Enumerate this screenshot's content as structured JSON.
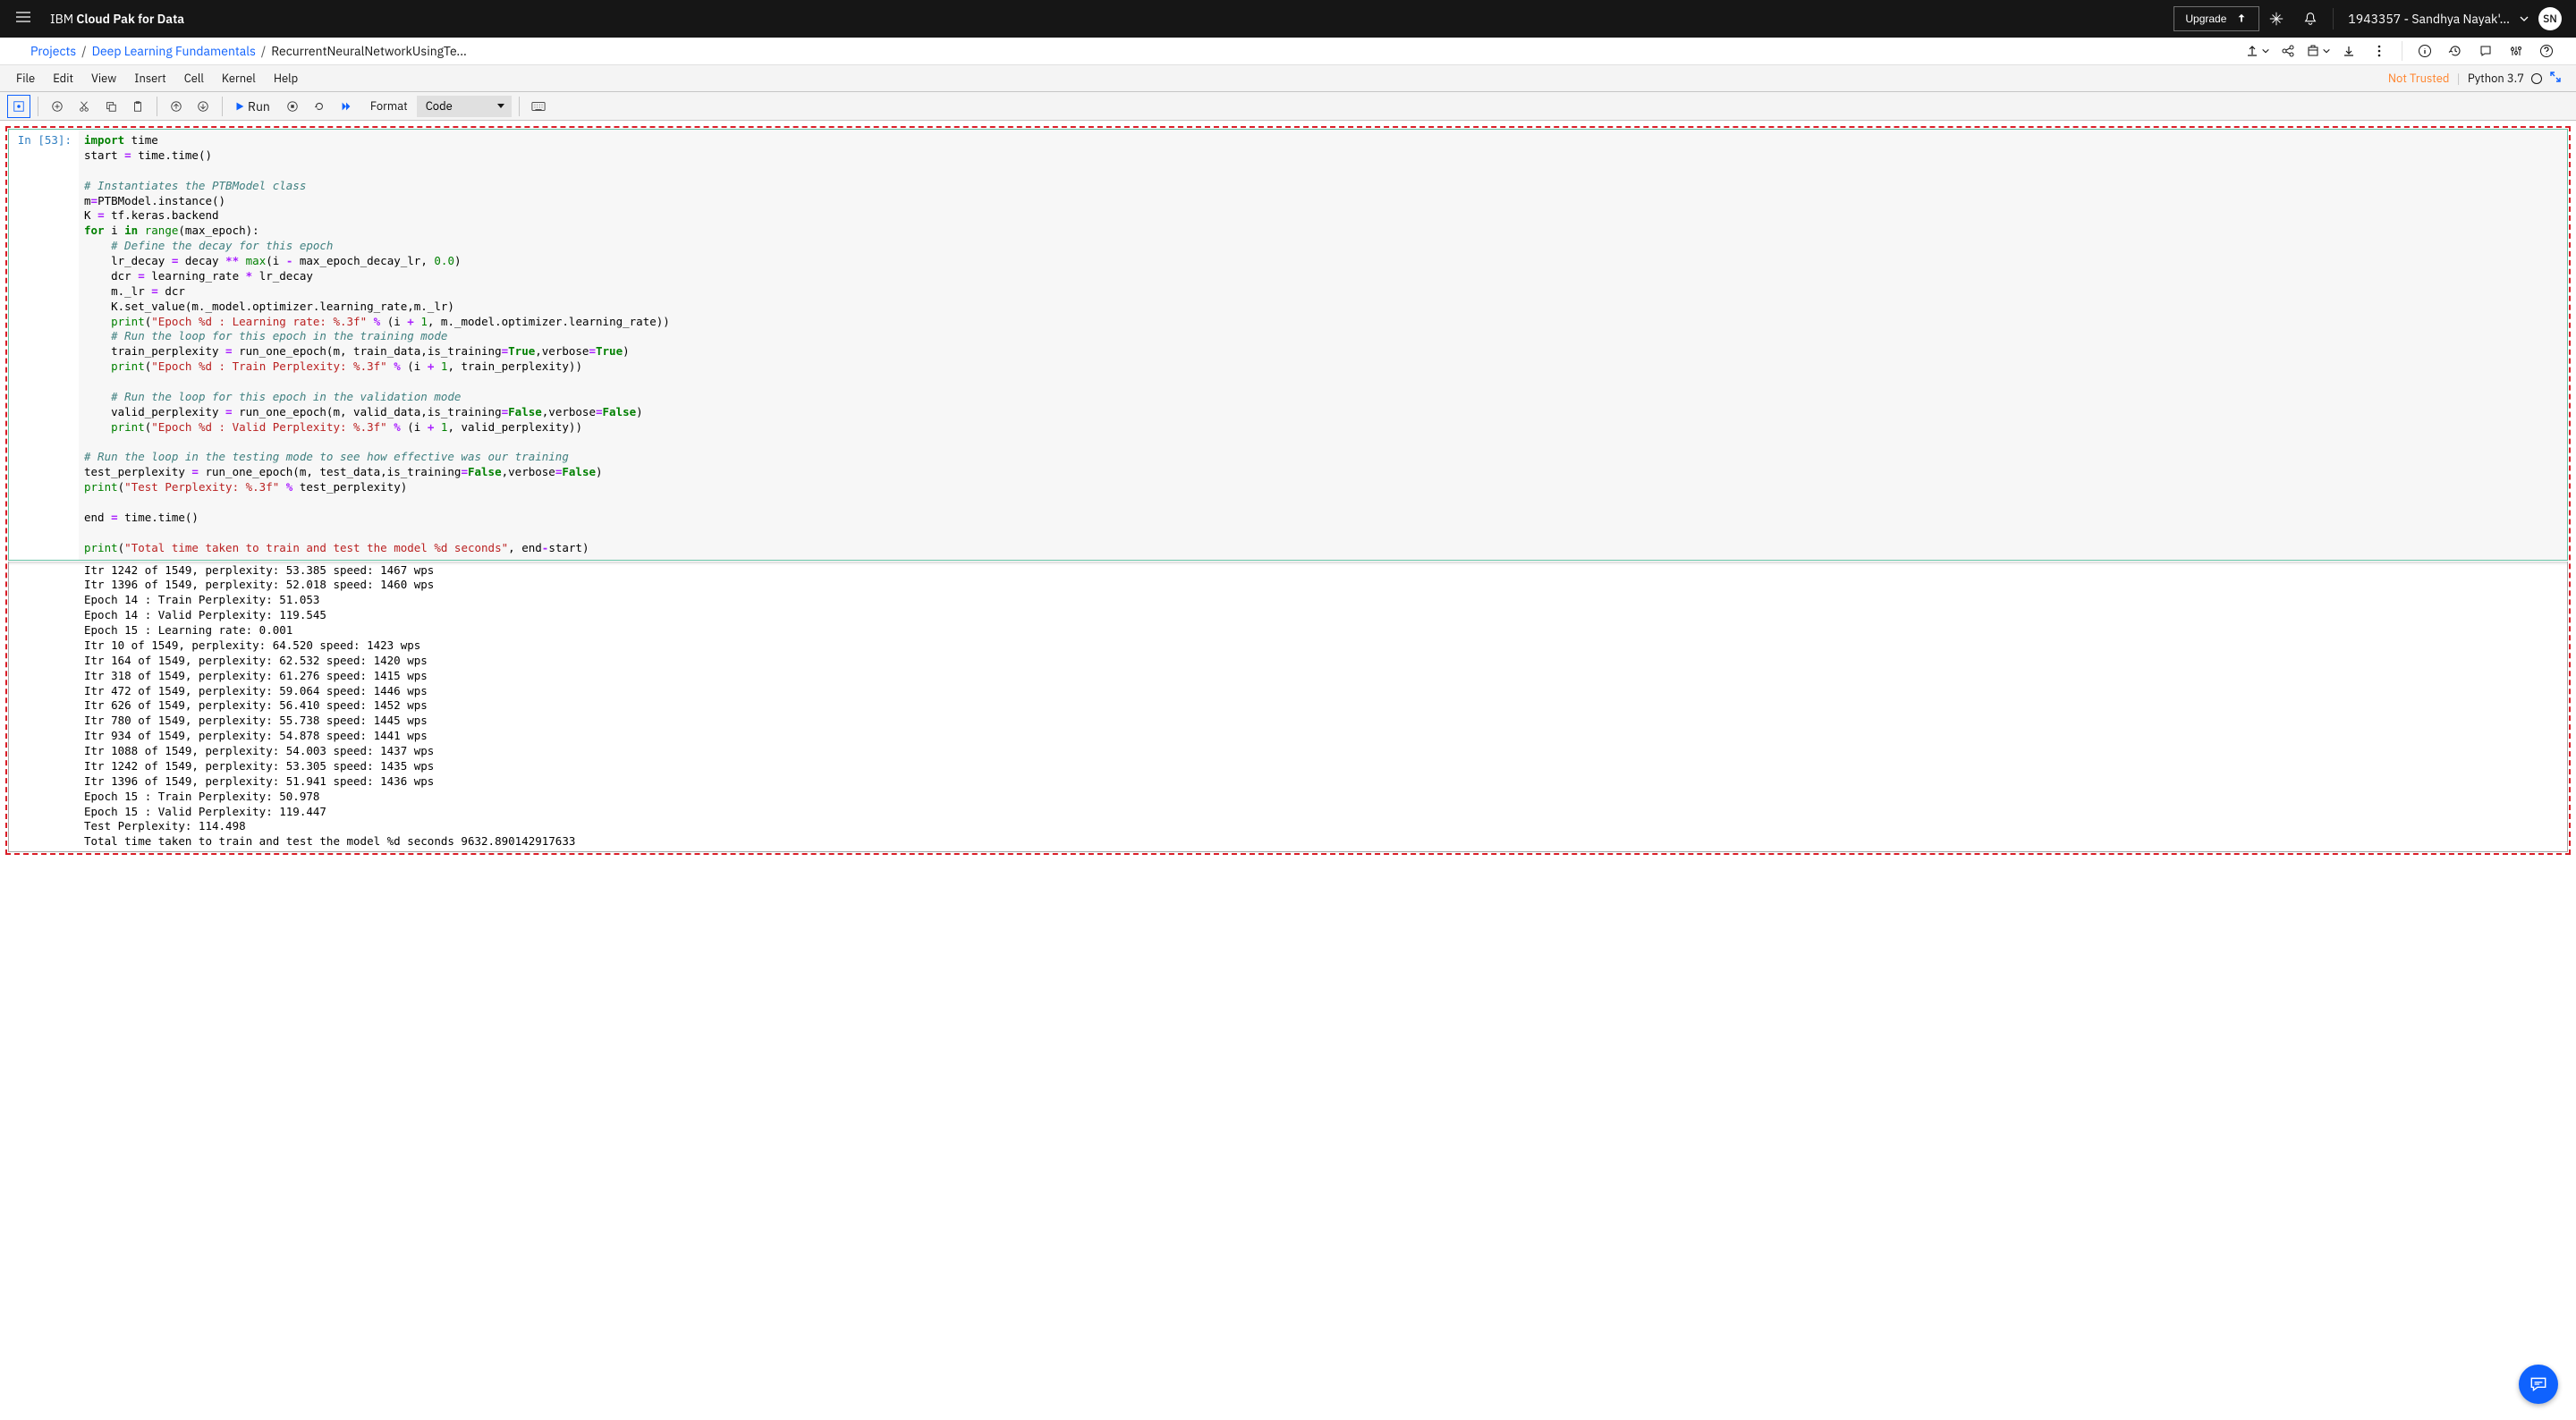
{
  "top": {
    "brand_light": "IBM ",
    "brand_bold": "Cloud Pak for Data",
    "upgrade_label": "Upgrade",
    "user_label": "1943357 - Sandhya Nayak'...",
    "avatar": "SN"
  },
  "crumbs": {
    "a": "Projects",
    "b": "Deep Learning Fundamentals",
    "c": "RecurrentNeuralNetworkUsingTe..."
  },
  "menu": {
    "file": "File",
    "edit": "Edit",
    "view": "View",
    "insert": "Insert",
    "cell": "Cell",
    "kernel": "Kernel",
    "help": "Help",
    "not_trusted": "Not Trusted",
    "kernel_name": "Python 3.7"
  },
  "toolbar": {
    "run_label": "Run",
    "format_label": "Format",
    "celltype": "Code"
  },
  "cell": {
    "prompt": "In [53]:",
    "lines": [
      {
        "t": "code",
        "s": [
          {
            "c": "kw",
            "v": "import"
          },
          {
            "v": " time"
          }
        ]
      },
      {
        "t": "code",
        "s": [
          {
            "v": "start "
          },
          {
            "c": "op",
            "v": "="
          },
          {
            "v": " time.time()"
          }
        ]
      },
      {
        "t": "blank"
      },
      {
        "t": "code",
        "s": [
          {
            "c": "cm",
            "v": "# Instantiates the PTBModel class"
          }
        ]
      },
      {
        "t": "code",
        "s": [
          {
            "v": "m"
          },
          {
            "c": "op",
            "v": "="
          },
          {
            "v": "PTBModel.instance()"
          }
        ]
      },
      {
        "t": "code",
        "s": [
          {
            "v": "K "
          },
          {
            "c": "op",
            "v": "="
          },
          {
            "v": " tf.keras.backend"
          }
        ]
      },
      {
        "t": "code",
        "s": [
          {
            "c": "kw",
            "v": "for"
          },
          {
            "v": " i "
          },
          {
            "c": "kw",
            "v": "in"
          },
          {
            "v": " "
          },
          {
            "c": "fn",
            "v": "range"
          },
          {
            "v": "(max_epoch):"
          }
        ]
      },
      {
        "t": "code",
        "i": 1,
        "s": [
          {
            "c": "cm",
            "v": "# Define the decay for this epoch"
          }
        ]
      },
      {
        "t": "code",
        "i": 1,
        "s": [
          {
            "v": "lr_decay "
          },
          {
            "c": "op",
            "v": "="
          },
          {
            "v": " decay "
          },
          {
            "c": "op",
            "v": "**"
          },
          {
            "v": " "
          },
          {
            "c": "fn",
            "v": "max"
          },
          {
            "v": "(i "
          },
          {
            "c": "op",
            "v": "-"
          },
          {
            "v": " max_epoch_decay_lr, "
          },
          {
            "c": "num",
            "v": "0.0"
          },
          {
            "v": ")"
          }
        ]
      },
      {
        "t": "code",
        "i": 1,
        "s": [
          {
            "v": "dcr "
          },
          {
            "c": "op",
            "v": "="
          },
          {
            "v": " learning_rate "
          },
          {
            "c": "op",
            "v": "*"
          },
          {
            "v": " lr_decay"
          }
        ]
      },
      {
        "t": "code",
        "i": 1,
        "s": [
          {
            "v": "m._lr "
          },
          {
            "c": "op",
            "v": "="
          },
          {
            "v": " dcr"
          }
        ]
      },
      {
        "t": "code",
        "i": 1,
        "s": [
          {
            "v": "K.set_value(m._model.optimizer.learning_rate,m._lr)"
          }
        ]
      },
      {
        "t": "code",
        "i": 1,
        "s": [
          {
            "c": "fn",
            "v": "print"
          },
          {
            "v": "("
          },
          {
            "c": "str",
            "v": "\"Epoch %d : Learning rate: %.3f\""
          },
          {
            "v": " "
          },
          {
            "c": "op",
            "v": "%"
          },
          {
            "v": " (i "
          },
          {
            "c": "op",
            "v": "+"
          },
          {
            "v": " "
          },
          {
            "c": "num",
            "v": "1"
          },
          {
            "v": ", m._model.optimizer.learning_rate))"
          }
        ]
      },
      {
        "t": "code",
        "i": 1,
        "s": [
          {
            "c": "cm",
            "v": "# Run the loop for this epoch in the training mode"
          }
        ]
      },
      {
        "t": "code",
        "i": 1,
        "s": [
          {
            "v": "train_perplexity "
          },
          {
            "c": "op",
            "v": "="
          },
          {
            "v": " run_one_epoch(m, train_data,is_training"
          },
          {
            "c": "op",
            "v": "="
          },
          {
            "c": "bool",
            "v": "True"
          },
          {
            "v": ",verbose"
          },
          {
            "c": "op",
            "v": "="
          },
          {
            "c": "bool",
            "v": "True"
          },
          {
            "v": ")"
          }
        ]
      },
      {
        "t": "code",
        "i": 1,
        "s": [
          {
            "c": "fn",
            "v": "print"
          },
          {
            "v": "("
          },
          {
            "c": "str",
            "v": "\"Epoch %d : Train Perplexity: %.3f\""
          },
          {
            "v": " "
          },
          {
            "c": "op",
            "v": "%"
          },
          {
            "v": " (i "
          },
          {
            "c": "op",
            "v": "+"
          },
          {
            "v": " "
          },
          {
            "c": "num",
            "v": "1"
          },
          {
            "v": ", train_perplexity))"
          }
        ]
      },
      {
        "t": "blank"
      },
      {
        "t": "code",
        "i": 1,
        "s": [
          {
            "c": "cm",
            "v": "# Run the loop for this epoch in the validation mode"
          }
        ]
      },
      {
        "t": "code",
        "i": 1,
        "s": [
          {
            "v": "valid_perplexity "
          },
          {
            "c": "op",
            "v": "="
          },
          {
            "v": " run_one_epoch(m, valid_data,is_training"
          },
          {
            "c": "op",
            "v": "="
          },
          {
            "c": "bool",
            "v": "False"
          },
          {
            "v": ",verbose"
          },
          {
            "c": "op",
            "v": "="
          },
          {
            "c": "bool",
            "v": "False"
          },
          {
            "v": ")"
          }
        ]
      },
      {
        "t": "code",
        "i": 1,
        "s": [
          {
            "c": "fn",
            "v": "print"
          },
          {
            "v": "("
          },
          {
            "c": "str",
            "v": "\"Epoch %d : Valid Perplexity: %.3f\""
          },
          {
            "v": " "
          },
          {
            "c": "op",
            "v": "%"
          },
          {
            "v": " (i "
          },
          {
            "c": "op",
            "v": "+"
          },
          {
            "v": " "
          },
          {
            "c": "num",
            "v": "1"
          },
          {
            "v": ", valid_perplexity))"
          }
        ]
      },
      {
        "t": "blank"
      },
      {
        "t": "code",
        "s": [
          {
            "c": "cm",
            "v": "# Run the loop in the testing mode to see how effective was our training"
          }
        ]
      },
      {
        "t": "code",
        "s": [
          {
            "v": "test_perplexity "
          },
          {
            "c": "op",
            "v": "="
          },
          {
            "v": " run_one_epoch(m, test_data,is_training"
          },
          {
            "c": "op",
            "v": "="
          },
          {
            "c": "bool",
            "v": "False"
          },
          {
            "v": ",verbose"
          },
          {
            "c": "op",
            "v": "="
          },
          {
            "c": "bool",
            "v": "False"
          },
          {
            "v": ")"
          }
        ]
      },
      {
        "t": "code",
        "s": [
          {
            "c": "fn",
            "v": "print"
          },
          {
            "v": "("
          },
          {
            "c": "str",
            "v": "\"Test Perplexity: %.3f\""
          },
          {
            "v": " "
          },
          {
            "c": "op",
            "v": "%"
          },
          {
            "v": " test_perplexity)"
          }
        ]
      },
      {
        "t": "blank"
      },
      {
        "t": "code",
        "s": [
          {
            "v": "end "
          },
          {
            "c": "op",
            "v": "="
          },
          {
            "v": " time.time()"
          }
        ]
      },
      {
        "t": "blank"
      },
      {
        "t": "code",
        "s": [
          {
            "c": "fn",
            "v": "print"
          },
          {
            "v": "("
          },
          {
            "c": "str",
            "v": "\"Total time taken to train and test the model %d seconds\""
          },
          {
            "v": ", end"
          },
          {
            "c": "op",
            "v": "-"
          },
          {
            "v": "start)"
          }
        ]
      }
    ]
  },
  "output_lines": [
    "Itr 1242 of 1549, perplexity: 53.385 speed: 1467 wps",
    "Itr 1396 of 1549, perplexity: 52.018 speed: 1460 wps",
    "Epoch 14 : Train Perplexity: 51.053",
    "Epoch 14 : Valid Perplexity: 119.545",
    "Epoch 15 : Learning rate: 0.001",
    "Itr 10 of 1549, perplexity: 64.520 speed: 1423 wps",
    "Itr 164 of 1549, perplexity: 62.532 speed: 1420 wps",
    "Itr 318 of 1549, perplexity: 61.276 speed: 1415 wps",
    "Itr 472 of 1549, perplexity: 59.064 speed: 1446 wps",
    "Itr 626 of 1549, perplexity: 56.410 speed: 1452 wps",
    "Itr 780 of 1549, perplexity: 55.738 speed: 1445 wps",
    "Itr 934 of 1549, perplexity: 54.878 speed: 1441 wps",
    "Itr 1088 of 1549, perplexity: 54.003 speed: 1437 wps",
    "Itr 1242 of 1549, perplexity: 53.305 speed: 1435 wps",
    "Itr 1396 of 1549, perplexity: 51.941 speed: 1436 wps",
    "Epoch 15 : Train Perplexity: 50.978",
    "Epoch 15 : Valid Perplexity: 119.447",
    "Test Perplexity: 114.498",
    "Total time taken to train and test the model %d seconds 9632.890142917633"
  ]
}
